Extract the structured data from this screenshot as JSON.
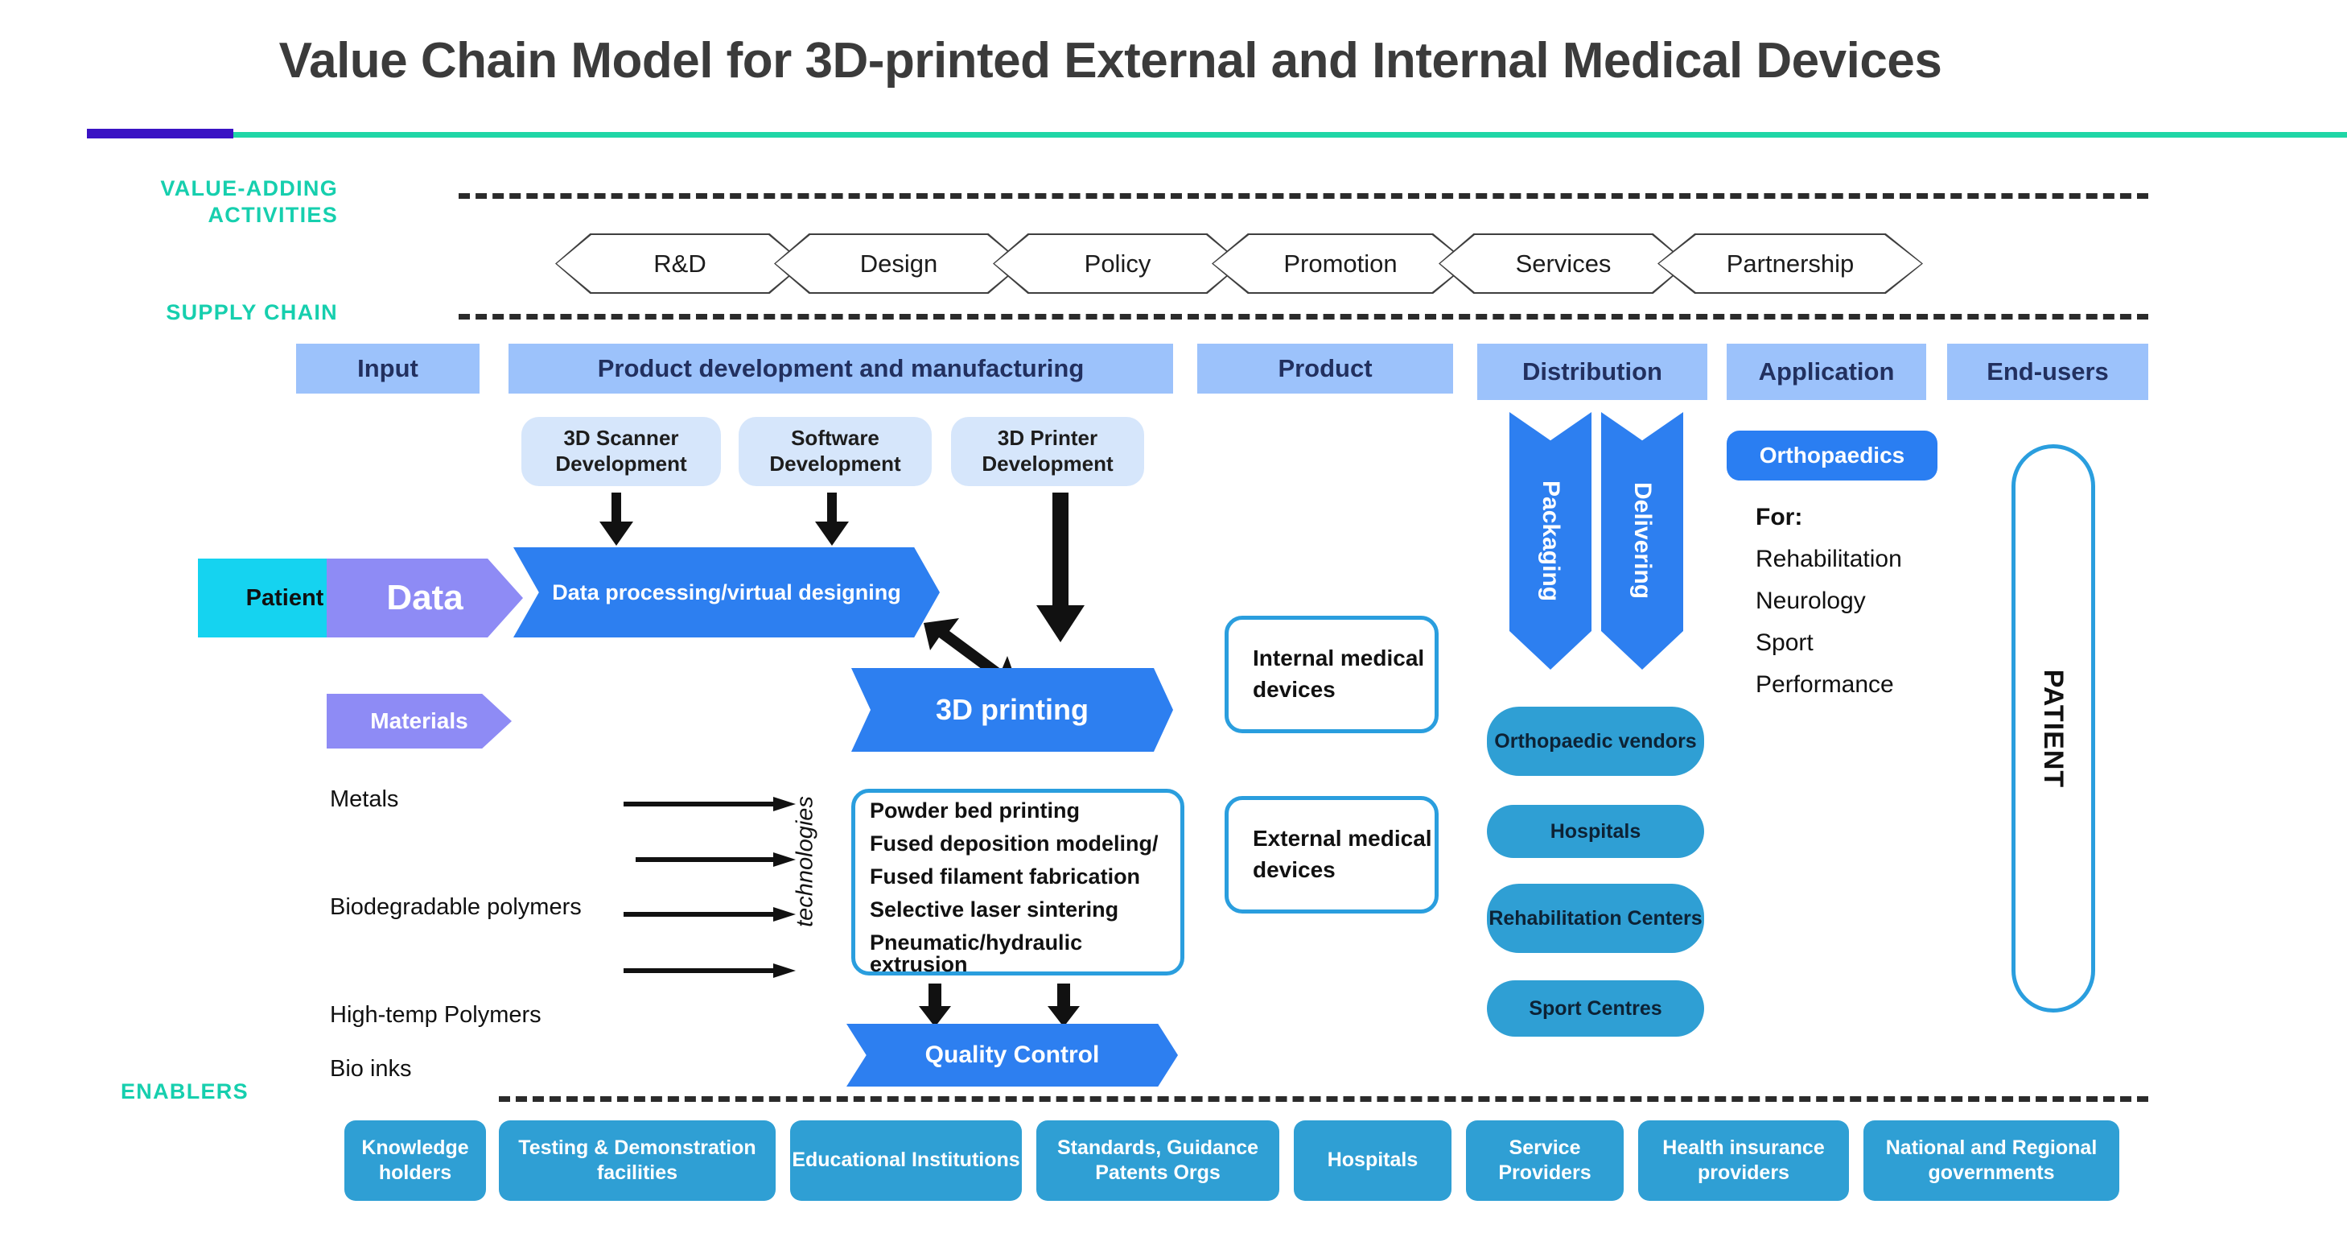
{
  "title": "Value Chain Model for 3D-printed External and Internal Medical Devices",
  "accent_colors": {
    "indigo": "#3a12c4",
    "teal": "#1fd6a6",
    "label_teal": "#16cfae",
    "bar_blue": "#9cc2fb",
    "chevron_blue": "#2d7ff0",
    "pill_teal": "#2f9fd4",
    "soft_blue": "#d6e6fb",
    "purple": "#8e8bf5",
    "cyan": "#15d3f0",
    "outline_blue": "#2a9ede"
  },
  "sections": {
    "value_adding_line1": "VALUE-ADDING",
    "value_adding_line2": "ACTIVITIES",
    "supply_chain": "SUPPLY CHAIN",
    "enablers": "ENABLERS"
  },
  "value_adding_activities": [
    "R&D",
    "Design",
    "Policy",
    "Promotion",
    "Services",
    "Partnership"
  ],
  "supply_chain_stages": [
    "Input",
    "Product development and manufacturing",
    "Product",
    "Distribution",
    "Application",
    "End-users"
  ],
  "development": [
    "3D Scanner Development",
    "Software Development",
    "3D Printer Development"
  ],
  "input_flow": {
    "patient": "Patient",
    "data": "Data",
    "data_processing": "Data processing/virtual designing",
    "materials": "Materials"
  },
  "materials_list": [
    "Metals",
    "Biodegradable polymers",
    "High-temp Polymers",
    "Bio inks"
  ],
  "printing": {
    "printing_label": "3D printing",
    "technologies_label": "technologies",
    "technologies": [
      "Powder bed printing",
      "Fused deposition modeling/",
      "Fused filament fabrication",
      "Selective laser sintering",
      "Pneumatic/hydraulic extrusion"
    ],
    "quality_control": "Quality Control"
  },
  "products": [
    "Internal medical devices",
    "External medical devices"
  ],
  "distribution": {
    "arrows": [
      "Packaging",
      "Delivering"
    ],
    "channels": [
      "Orthopaedic vendors",
      "Hospitals",
      "Rehabilitation Centers",
      "Sport Centres"
    ]
  },
  "application": {
    "specialty": "Orthopaedics",
    "for_label": "For:",
    "uses": [
      "Rehabilitation",
      "Neurology",
      "Sport",
      "Performance"
    ]
  },
  "end_users": {
    "patient": "PATIENT"
  },
  "enablers": [
    "Knowledge holders",
    "Testing & Demonstration facilities",
    "Educational Institutions",
    "Standards, Guidance Patents Orgs",
    "Hospitals",
    "Service Providers",
    "Health insurance providers",
    "National and Regional governments"
  ]
}
